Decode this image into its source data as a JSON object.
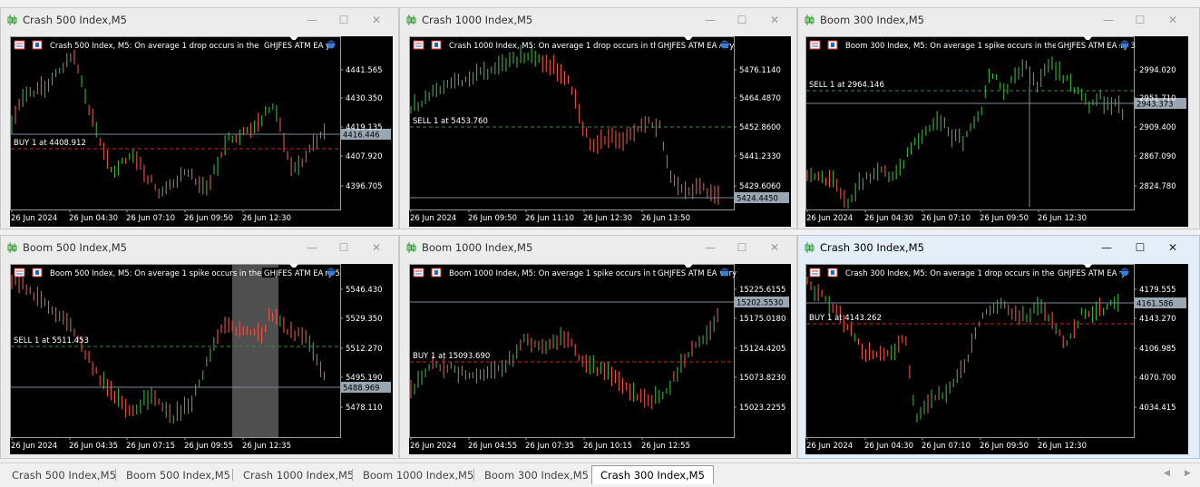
{
  "windows": [
    {
      "id": "w1",
      "title": "Crash 500 Index,M5",
      "chart_title": "Crash 500 Index, M5:  On average 1 drop occurs in the price series every",
      "ea_label": "GHJFES ATM EA",
      "trade": "BUY 1 at 4408.912",
      "prices": [
        "4441.565",
        "4430.350",
        "4419.135",
        "4407.920",
        "4396.705"
      ],
      "current_price": "4416.446",
      "times": [
        "26 Jun 2024",
        "26 Jun 04:30",
        "26 Jun 07:10",
        "26 Jun 09:50",
        "26 Jun 12:30"
      ]
    },
    {
      "id": "w2",
      "title": "Crash 1000 Index,M5",
      "chart_title": "Crash 1000 Index, M5:  On average 1 drop occurs in the price series every",
      "ea_label": "GHJFES ATM EA",
      "trade": "SELL 1 at 5453.760",
      "prices": [
        "5476.1140",
        "5464.4870",
        "5452.8600",
        "5441.2330",
        "5429.6060"
      ],
      "current_price": "5424.4450",
      "times": [
        "26 Jun 2024",
        "26 Jun 09:50",
        "26 Jun 11:10",
        "26 Jun 12:30",
        "26 Jun 13:50"
      ]
    },
    {
      "id": "w3",
      "title": "Boom 300 Index,M5",
      "chart_title": "Boom 300 Index, M5:  On average 1 spike occurs in the price series every 3",
      "ea_label": "GHJFES ATM EA",
      "trade": "SELL 1 at 2964.146",
      "prices": [
        "2994.020",
        "2951.710",
        "2909.400",
        "2867.090",
        "2824.780"
      ],
      "current_price": "2943.373",
      "times": [
        "26 Jun 2024",
        "26 Jun 04:30",
        "26 Jun 07:10",
        "26 Jun 09:50",
        "26 Jun 12:30"
      ]
    },
    {
      "id": "w4",
      "title": "Boom 500 Index,M5",
      "chart_title": "Boom 500 Index, M5:  On average 1 spike occurs in the price series every 5",
      "ea_label": "GHJFES ATM EA",
      "trade": "SELL 1 at 5511.453",
      "prices": [
        "5546.430",
        "5529.350",
        "5512.270",
        "5495.190",
        "5478.110"
      ],
      "current_price": "5488.969",
      "times": [
        "26 Jun 2024",
        "26 Jun 04:35",
        "26 Jun 07:15",
        "26 Jun 09:55",
        "26 Jun 12:35"
      ]
    },
    {
      "id": "w5",
      "title": "Boom 1000 Index,M5",
      "chart_title": "Boom 1000 Index, M5:  On average 1 spike occurs in the price series every",
      "ea_label": "GHJFES ATM EA",
      "trade": "BUY 1 at 15093.690",
      "prices": [
        "15225.6155",
        "15175.0180",
        "15124.4205",
        "15073.8230",
        "15023.2255"
      ],
      "current_price": "15202.5530",
      "times": [
        "26 Jun 2024",
        "26 Jun 04:55",
        "26 Jun 07:35",
        "26 Jun 10:15",
        "26 Jun 12:55"
      ]
    },
    {
      "id": "w6",
      "title": "Crash 300 Index,M5",
      "chart_title": "Crash 300 Index, M5:  On average 1 drop occurs in the price series every",
      "ea_label": "GHJFES ATM EA",
      "trade": "BUY 1 at 4143.262",
      "prices": [
        "4179.555",
        "4143.270",
        "4106.985",
        "4070.700",
        "4034.415"
      ],
      "current_price": "4161.586",
      "times": [
        "26 Jun 2024",
        "26 Jun 04:30",
        "26 Jun 07:10",
        "26 Jun 09:50",
        "26 Jun 12:30"
      ]
    }
  ],
  "tabs": [
    "Crash 500 Index,M5",
    "Boom 500 Index,M5",
    "Crash 1000 Index,M5",
    "Boom 1000 Index,M5",
    "Boom 300 Index,M5",
    "Crash 300 Index,M5"
  ],
  "active_tab": 5,
  "controls": {
    "minimize": "—",
    "maximize": "☐",
    "close": "✕"
  },
  "colors": {
    "bull": "#3cb043",
    "bear": "#e8564b",
    "level_buy": "#c62828",
    "level_sell": "#3a8a3a",
    "price_line": "#7a8a9a",
    "chart_bg": "#000000",
    "axis_text": "#ffffff"
  },
  "icons": [
    "chart-bars-icon",
    "trade-icon",
    "ea-hat-icon",
    "scroll-left-icon",
    "scroll-right-icon"
  ]
}
